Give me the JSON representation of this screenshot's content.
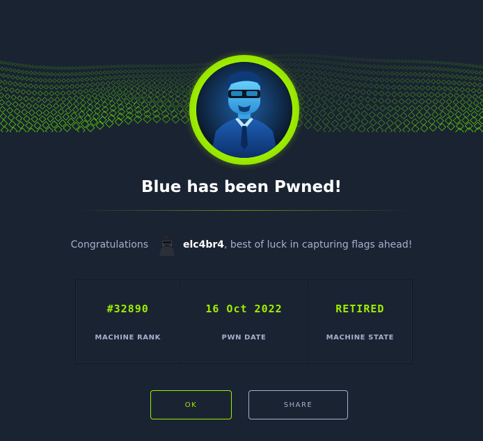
{
  "dialog": {
    "title": "Blue has been Pwned!",
    "congrats_prefix": "Congratulations",
    "username": "elc4br4",
    "congrats_suffix": ", best of luck in capturing flags ahead!"
  },
  "stats": [
    {
      "value": "#32890",
      "label": "MACHINE RANK"
    },
    {
      "value": "16 Oct 2022",
      "label": "PWN DATE"
    },
    {
      "value": "RETIRED",
      "label": "MACHINE STATE"
    }
  ],
  "buttons": {
    "ok_label": "OK",
    "share_label": "SHARE"
  },
  "icons": {
    "machine_avatar": "blue-agent-avatar-icon",
    "user_avatar": "hacker-avatar-icon"
  },
  "colors": {
    "accent": "#9fef00",
    "background": "#1a2332",
    "text_muted": "#a4b1cd",
    "text_strong": "#ffffff"
  }
}
